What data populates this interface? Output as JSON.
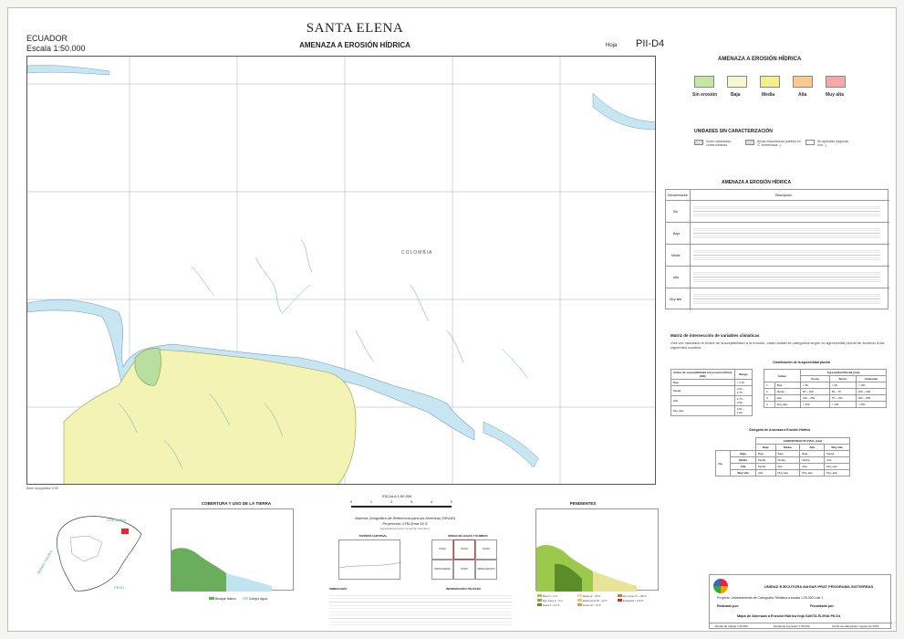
{
  "header": {
    "country": "ECUADOR",
    "scale": "Escala 1:50.000",
    "title": "SANTA ELENA",
    "subtitle": "AMENAZA A EROSIÓN HÍDRICA",
    "hoja_label": "Hoja",
    "hoja_value": "PII-D4"
  },
  "map": {
    "place_label": "COLOMBIA",
    "colors": {
      "baja": "#f3f3b4",
      "sin_erosion": "#b9dea0",
      "water": "#c8e6f2",
      "drainage": "#6f9fc4",
      "grid": "#999999"
    }
  },
  "legend": {
    "title": "AMENAZA A EROSIÓN HÍDRICA",
    "classes": [
      {
        "label": "Sin erosión",
        "color": "#c6e6a6"
      },
      {
        "label": "Baja",
        "color": "#f7f6d2"
      },
      {
        "label": "Media",
        "color": "#f3ef8a"
      },
      {
        "label": "Alta",
        "color": "#f9c98e"
      },
      {
        "label": "Muy alta",
        "color": "#f6a9a6"
      }
    ],
    "unidades_title": "UNIDADES SIN CARACTERIZACIÓN",
    "unidades": [
      {
        "label": "Suelo urbanizado, zonas urbanas"
      },
      {
        "label": "Áreas misceláneas (caribes en 'C' tormentosa...)"
      },
      {
        "label": "No aplicable (lagunas, ríos...)"
      }
    ]
  },
  "description_table": {
    "title": "AMENAZA A EROSIÓN HÍDRICA",
    "col_1": "Denominación",
    "col_2": "Descripción",
    "rows": [
      {
        "name": "Sin"
      },
      {
        "name": "Baja"
      },
      {
        "name": "Media"
      },
      {
        "name": "Alta"
      },
      {
        "name": "Muy alta"
      }
    ]
  },
  "matrix": {
    "title": "Matriz de intersección de variables climáticas",
    "intro": "Una vez calculado el índice de susceptibilidad a la erosión, cada unidad se categoriza según su agresividad pluvial de acuerdo a las siguientes cuadros:",
    "clasif_title": "Clasificación de la agresividad pluvial",
    "susc_headers": [
      "Índice de susceptibilidad a la erosión hídrica (ISE)",
      "Rango"
    ],
    "susc_rows": [
      [
        "Baja",
        "< 2,21"
      ],
      [
        "Media",
        "2,21 – 2,75"
      ],
      [
        "Alta",
        "2,76 – 3,50"
      ],
      [
        "Muy alta",
        "3,51 – 4,00"
      ]
    ],
    "agr_headers": [
      "Índice",
      "Agresividad Pluvial (mm)"
    ],
    "agr_subheaders": [
      "Costa",
      "Sierra",
      "Amazonía"
    ],
    "agr_rows": [
      [
        "1",
        "Baja",
        "< 50",
        "< 50",
        "< 150"
      ],
      [
        "2",
        "Media",
        "50 – 150",
        "50 – 75",
        "150 – 200"
      ],
      [
        "3",
        "Alta",
        "150 – 250",
        "75 – 100",
        "200 – 250"
      ],
      [
        "4",
        "Muy alta",
        "> 250",
        "> 100",
        "> 250"
      ]
    ],
    "categoria_title": "Categoría de Amenaza a Erosión Hídrica",
    "categoria_header": "AGRESIVIDAD PLUVIAL (mm)",
    "categoria_cols": [
      "Baja",
      "Media",
      "Alta",
      "Muy alta"
    ],
    "categoria_side": "ISE",
    "categoria_rows": [
      [
        "Baja",
        "Baja",
        "Baja",
        "Baja",
        "Media"
      ],
      [
        "Media",
        "Media",
        "Media",
        "Media",
        "Alta"
      ],
      [
        "Alta",
        "Media",
        "Alta",
        "Alta",
        "Muy alta"
      ],
      [
        "Muy alta",
        "Alta",
        "Muy alta",
        "Muy alta",
        "Muy alta"
      ]
    ]
  },
  "bottom": {
    "base_note": "Base topográfica: IGM",
    "inset_cobertura": "COBERTURA Y USO DE LA TIERRA",
    "inset_pendientes": "PENDIENTES",
    "cobertura_legend": [
      "Bosque Nativo",
      "Cuerpo Agua"
    ],
    "scale_label": "ESCALA 1:50.000",
    "scale_ticks": [
      "0",
      "1",
      "2",
      "3",
      "4",
      "5"
    ],
    "scale_unit": "km",
    "projection_1": "Sistema Geográfico de Referencia para las Américas SIRGAS",
    "projection_2": "Proyección UTM Zona 16 S",
    "projection_3": "Equidistancia entre curvas de nivel 40 m",
    "division_title": "DIVISIÓN CANTONAL",
    "indice_title": "ÍNDICE DE HOJAS Y RUMBOS",
    "indice_cells": [
      "PII-D2",
      "PII-D3",
      "PII-D4",
      "PII-D5",
      "SANTA ELENA",
      "MANGLARALTO"
    ],
    "simbolos_title": "SIMBOLOGÍA",
    "info_title": "INFORMACIÓN UTILIZADA",
    "mini_map_labels": [
      "COLOMBIA",
      "PERÚ",
      "Océano Pacífico"
    ],
    "pendientes_legend": [
      "Plano 0 – 2 %",
      "Muy suave 2 – 5 %",
      "Suave 5 – 12 %",
      "Media 12 – 25 %",
      "Media fuerte 25 – 40 %",
      "Fuerte 40 – 70 %",
      "Muy fuerte 70 – 100 %",
      "Escarpada > 100 %"
    ],
    "unit_title": "UNIDAD EJECUTORA MAGAP-PRAT PROGRAMA SIGTIERRAS",
    "project": "Proyecto:   Levantamiento de Cartografía Temática a escala 1:25.000  Lote 1",
    "realizado": "Realizado por:",
    "fiscalizado": "Fiscalizado por:",
    "map_name": "Mapa de Amenaza a Erosión Hídrica hoja SANTA ELENA PII-D4",
    "footer_1": "Escala de trabajo 1:25.000",
    "footer_2": "Escala de impresión 1:50.000",
    "footer_3": "Fecha de elaboración: agosto de 2015"
  }
}
